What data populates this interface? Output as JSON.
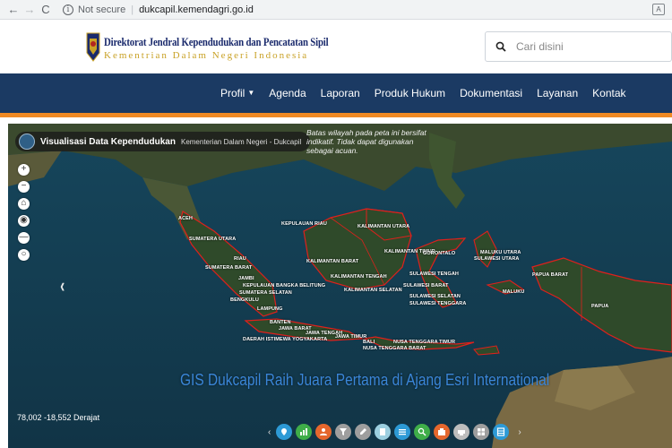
{
  "browser": {
    "back_icon": "back-arrow-icon",
    "forward_icon": "forward-arrow-icon",
    "reload_icon": "reload-icon",
    "security_label": "Not secure",
    "url": "dukcapil.kemendagri.go.id"
  },
  "header": {
    "title": "Direktorat Jendral Kependudukan dan Pencatatan Sipil",
    "subtitle": "Kementrian Dalam Negeri Indonesia",
    "search_placeholder": "Cari disini",
    "title_color": "#1a2a6c",
    "subtitle_color": "#c9a227"
  },
  "nav": {
    "items": [
      "Profil",
      "Agenda",
      "Laporan",
      "Produk Hukum",
      "Dokumentasi",
      "Layanan",
      "Kontak"
    ],
    "background": "#1b3a63",
    "accent_color": "#f08a24"
  },
  "map": {
    "app_title": "Visualisasi Data Kependudukan",
    "app_subtitle": "Kementerian Dalam Negeri - Dukcapil",
    "disclaimer": "Batas wilayah pada peta ini bersifat indikatif. Tidak dapat digunakan sebagai acuan.",
    "coordinates": "78,002 -18,552 Derajat",
    "headline": "GIS Dukcapil Raih Juara Pertama di Ajang Esri International",
    "headline_color": "#3a86d8",
    "province_labels": [
      "ACEH",
      "SUMATERA UTARA",
      "RIAU",
      "SUMATERA BARAT",
      "KEPULAUAN RIAU",
      "JAMBI",
      "KEPULAUAN BANGKA BELITUNG",
      "SUMATERA SELATAN",
      "BENGKULU",
      "LAMPUNG",
      "BANTEN",
      "JAWA BARAT",
      "JAWA TENGAH",
      "JAWA TIMUR",
      "DAERAH ISTIMEWA YOGYAKARTA",
      "BALI",
      "NUSA TENGGARA BARAT",
      "NUSA TENGGARA TIMUR",
      "KALIMANTAN UTARA",
      "KALIMANTAN TIMUR",
      "KALIMANTAN BARAT",
      "KALIMANTAN TENGAH",
      "KALIMANTAN SELATAN",
      "GORONTALO",
      "SULAWESI UTARA",
      "SULAWESI TENGAH",
      "SULAWESI BARAT",
      "SULAWESI SELATAN",
      "SULAWESI TENGGARA",
      "MALUKU UTARA",
      "MALUKU",
      "PAPUA BARAT",
      "PAPUA"
    ],
    "boundary_color": "#e0201c",
    "zoom_controls": [
      "+",
      "−",
      "⌂",
      "◉",
      "—",
      "○"
    ],
    "tools": [
      {
        "icon": "pin-icon",
        "color": "#2d9ad6"
      },
      {
        "icon": "chart-icon",
        "color": "#3fae49"
      },
      {
        "icon": "person-icon",
        "color": "#e5672d"
      },
      {
        "icon": "filter-icon",
        "color": "#9e9e9e"
      },
      {
        "icon": "pencil-icon",
        "color": "#9e9e9e"
      },
      {
        "icon": "print-icon",
        "color": "#9ccfe0"
      },
      {
        "icon": "list-icon",
        "color": "#2d9ad6"
      },
      {
        "icon": "search-icon",
        "color": "#3fae49"
      },
      {
        "icon": "share-icon",
        "color": "#e5672d"
      },
      {
        "icon": "printer-icon",
        "color": "#bdbdbd"
      },
      {
        "icon": "grid-icon",
        "color": "#9e9e9e"
      },
      {
        "icon": "table-icon",
        "color": "#2d9ad6"
      }
    ]
  }
}
